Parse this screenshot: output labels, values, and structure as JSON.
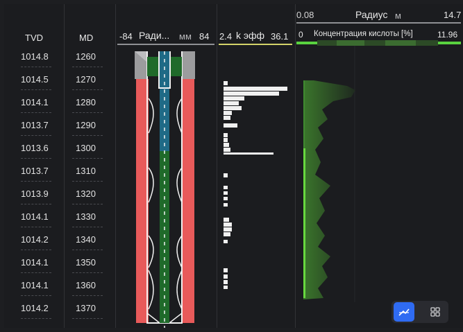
{
  "columns": {
    "tvd": {
      "header": "TVD"
    },
    "md": {
      "header": "MD"
    }
  },
  "rows": [
    {
      "tvd": "1014.8",
      "md": "1260"
    },
    {
      "tvd": "1014.5",
      "md": "1270"
    },
    {
      "tvd": "1014.1",
      "md": "1280"
    },
    {
      "tvd": "1013.7",
      "md": "1290"
    },
    {
      "tvd": "1013.6",
      "md": "1300"
    },
    {
      "tvd": "1013.7",
      "md": "1310"
    },
    {
      "tvd": "1013.9",
      "md": "1320"
    },
    {
      "tvd": "1014.1",
      "md": "1330"
    },
    {
      "tvd": "1014.2",
      "md": "1340"
    },
    {
      "tvd": "1014.1",
      "md": "1350"
    },
    {
      "tvd": "1014.1",
      "md": "1360"
    },
    {
      "tvd": "1014.2",
      "md": "1370"
    }
  ],
  "tracks": {
    "radius_track": {
      "min": "-84",
      "label": "Ради...",
      "unit": "мм",
      "max": "84",
      "line_color": "#8f9094"
    },
    "k_track": {
      "min": "2.4",
      "label": "k эфф",
      "max": "36.1",
      "line_color": "#d4d46a"
    },
    "radius_m_track": {
      "min": "0.08",
      "label": "Радиус",
      "unit": "м",
      "max": "14.7",
      "line_color": "#8f9094"
    },
    "acid_track": {
      "min": "0",
      "label": "Концентрация кислоты [%]",
      "max": "11.96",
      "line_color": "#59d23f"
    }
  },
  "colors": {
    "casing": "#e85a5a",
    "tubing_blue": "#1f6a86",
    "tubing_green": "#1f6a2a",
    "acid_green": "#3c8a2c",
    "accent": "#2f6bf2"
  },
  "toolbar": {
    "buttons": [
      {
        "name": "line-mode-icon",
        "active": true
      },
      {
        "name": "grid-mode-icon",
        "active": false
      }
    ]
  }
}
